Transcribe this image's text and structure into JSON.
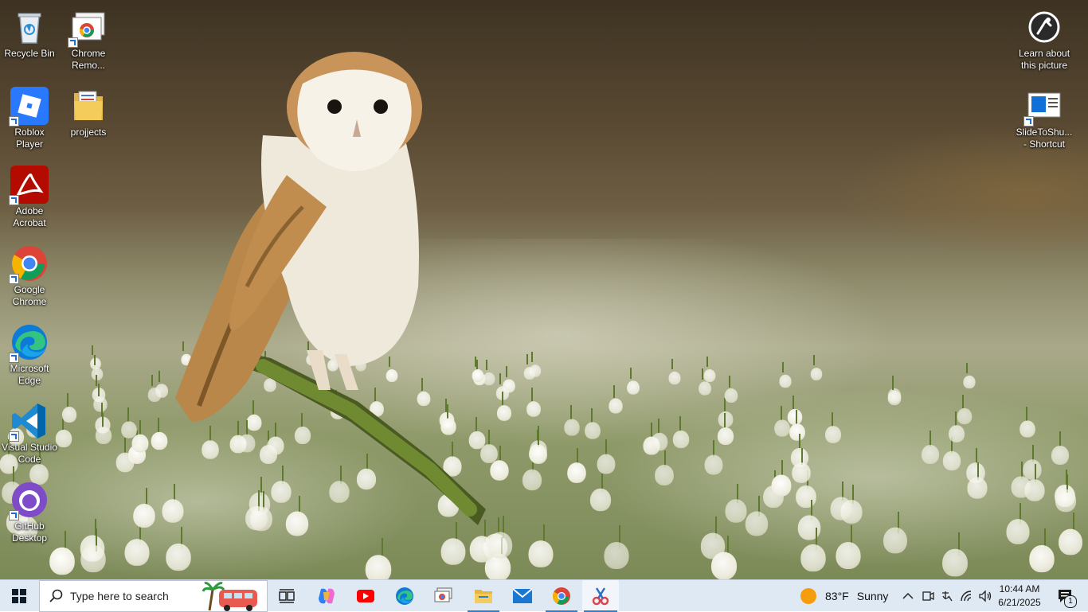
{
  "desktop": {
    "icons_left": [
      {
        "id": "recycle-bin",
        "label": "Recycle Bin"
      },
      {
        "id": "chrome-remote",
        "label": "Chrome Remo..."
      },
      {
        "id": "roblox",
        "label": "Roblox Player"
      },
      {
        "id": "projjects",
        "label": "projjects"
      },
      {
        "id": "acrobat",
        "label": "Adobe Acrobat"
      },
      {
        "id": "chrome",
        "label": "Google Chrome"
      },
      {
        "id": "edge",
        "label": "Microsoft Edge"
      },
      {
        "id": "vscode",
        "label": "Visual Studio Code"
      },
      {
        "id": "github",
        "label": "GitHub Desktop"
      }
    ],
    "icons_right": [
      {
        "id": "learn-picture",
        "label": "Learn about this picture"
      },
      {
        "id": "slidetoshutdown",
        "label": "SlideToShu... - Shortcut"
      }
    ]
  },
  "taskbar": {
    "search_placeholder": "Type here to search",
    "weather": {
      "temp": "83°F",
      "condition": "Sunny"
    },
    "clock": {
      "time": "10:44 AM",
      "date": "6/21/2025"
    },
    "notification_count": "1",
    "apps": [
      "task-view",
      "copilot",
      "youtube",
      "edge",
      "remote-desktop",
      "file-explorer",
      "mail",
      "chrome",
      "snipping-tool"
    ]
  },
  "colors": {
    "taskbar_bg": "#dfe9f3",
    "accent": "#2a7fd4"
  }
}
